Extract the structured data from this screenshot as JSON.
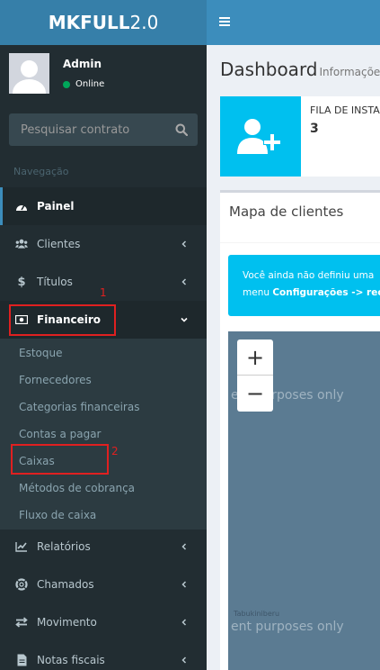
{
  "logo": {
    "bold": "MKFULL",
    "version": "2.0"
  },
  "user": {
    "name": "Admin",
    "status": "Online"
  },
  "search": {
    "placeholder": "Pesquisar contrato"
  },
  "nav": {
    "header": "Navegação",
    "painel": "Painel",
    "clientes": "Clientes",
    "titulos": "Títulos",
    "financeiro": "Financeiro",
    "financeiro_submenu": [
      "Estoque",
      "Fornecedores",
      "Categorias financeiras",
      "Contas a pagar",
      "Caixas",
      "Métodos de cobrança",
      "Fluxo de caixa"
    ],
    "relatorios": "Relatórios",
    "chamados": "Chamados",
    "movimento": "Movimento",
    "notas_fiscais": "Notas fiscais"
  },
  "annotations": {
    "mark1": "1",
    "mark2": "2"
  },
  "page": {
    "title": "Dashboard",
    "subtitle": "Informações"
  },
  "infobox": {
    "label": "FILA DE INSTALAÇÃO",
    "value": "3"
  },
  "map_box": {
    "title": "Mapa de clientes",
    "alert_line1": "Você ainda não definiu uma",
    "alert_line2_prefix": "menu ",
    "alert_line2_bold": "Configurações -> recursos",
    "zoom_in": "+",
    "zoom_out": "−",
    "watermark_top": "ent purposes only",
    "watermark_bottom": "ent purposes only",
    "place_name": "Tabukiniberu"
  },
  "colors": {
    "sidebar": "#222d32",
    "topbar": "#3c8dbc",
    "logo_bg": "#367fa9",
    "info": "#00c0ef",
    "annotation": "#e02020"
  }
}
